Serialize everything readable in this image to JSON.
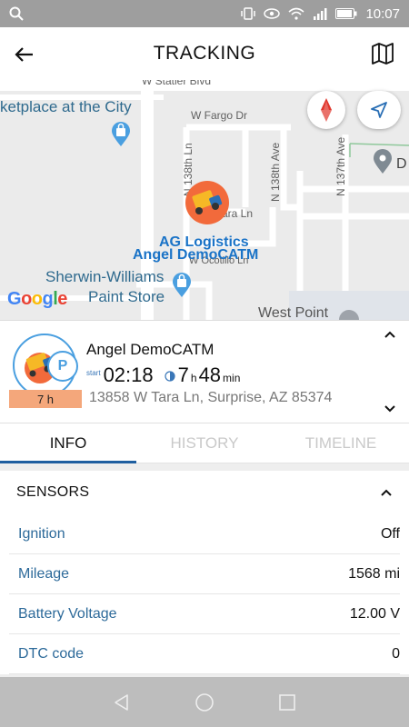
{
  "status_bar": {
    "time": "10:07"
  },
  "app_bar": {
    "title": "TRACKING"
  },
  "map": {
    "streets": [
      "W Statler Blvd",
      "W Fargo Dr",
      "N 138th Ln",
      "N 138th Ave",
      "N 137th Ave",
      "Tara Ln",
      "W Ocotillo Ln"
    ],
    "pois": {
      "marketplace": "ketplace at the City",
      "sherwin_line1": "Sherwin-Williams",
      "sherwin_line2": "Paint Store",
      "west_point": "West Point",
      "d_letter": "D"
    },
    "vehicle_company": "AG Logistics",
    "vehicle_name": "Angel DemoCATM",
    "google": [
      "G",
      "o",
      "o",
      "g",
      "l",
      "e"
    ]
  },
  "vehicle": {
    "name": "Angel DemoCATM",
    "start_label": "start",
    "start_time": "02:18",
    "duration_hours": "7",
    "duration_hours_unit": "h",
    "duration_minutes": "48",
    "duration_minutes_unit": "min",
    "address": "13858 W Tara Ln, Surprise, AZ 85374",
    "badge_duration": "7 h",
    "parking_glyph": "P"
  },
  "tabs": [
    {
      "label": "INFO"
    },
    {
      "label": "HISTORY"
    },
    {
      "label": "TIMELINE"
    }
  ],
  "sensors": {
    "title": "SENSORS",
    "rows": [
      {
        "label": "Ignition",
        "value": "Off"
      },
      {
        "label": "Mileage",
        "value": "1568 mi"
      },
      {
        "label": "Battery Voltage",
        "value": "12.00 V"
      },
      {
        "label": "DTC code",
        "value": "0"
      }
    ]
  },
  "colors": {
    "accent": "#1f5fa0",
    "badge": "#f4a77b",
    "link": "#2d6a9a"
  }
}
